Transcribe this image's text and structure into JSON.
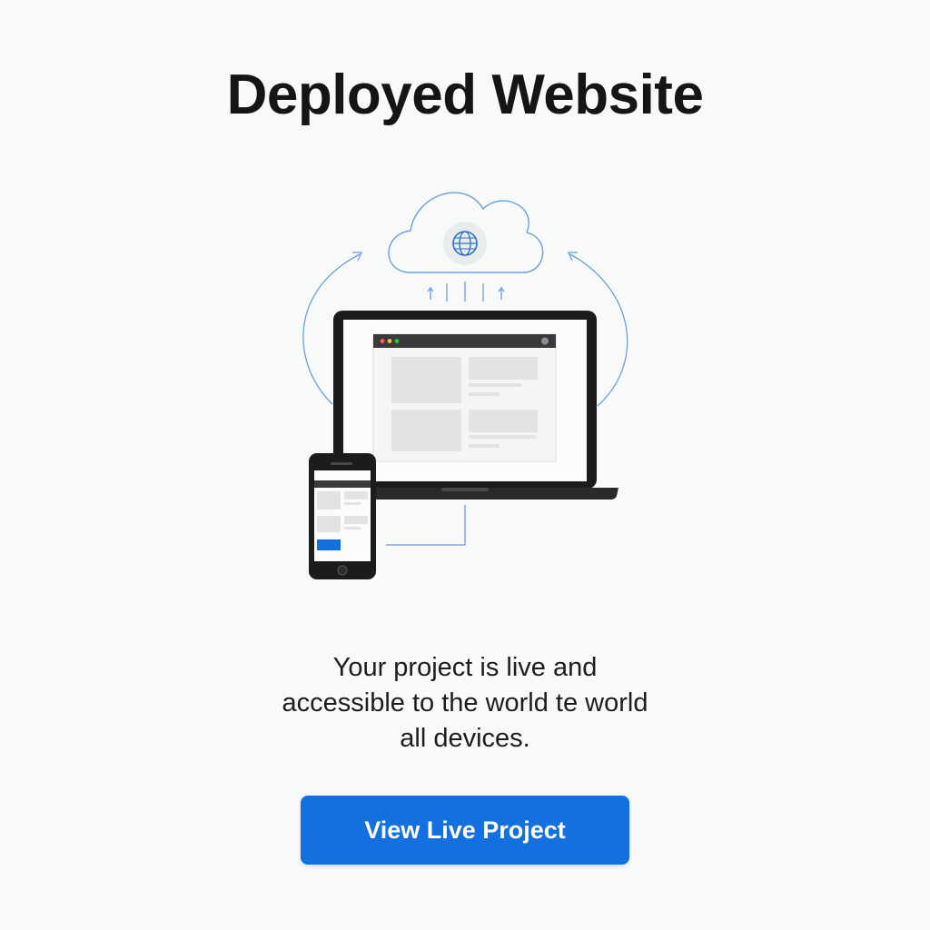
{
  "page": {
    "title": "Deployed Website"
  },
  "message": {
    "lines": [
      "Your project is live and",
      "accessible to the world te world",
      "all devices."
    ]
  },
  "cta": {
    "label": "View Live Project"
  },
  "icons": {
    "cloud": "cloud-icon",
    "globe": "globe-icon",
    "laptop": "laptop-icon",
    "phone": "smartphone-icon"
  },
  "colors": {
    "accent": "#1470e0",
    "line_blue": "#6a9fd8",
    "device_dark": "#1c1c1e",
    "placeholder": "#e3e3e3"
  }
}
